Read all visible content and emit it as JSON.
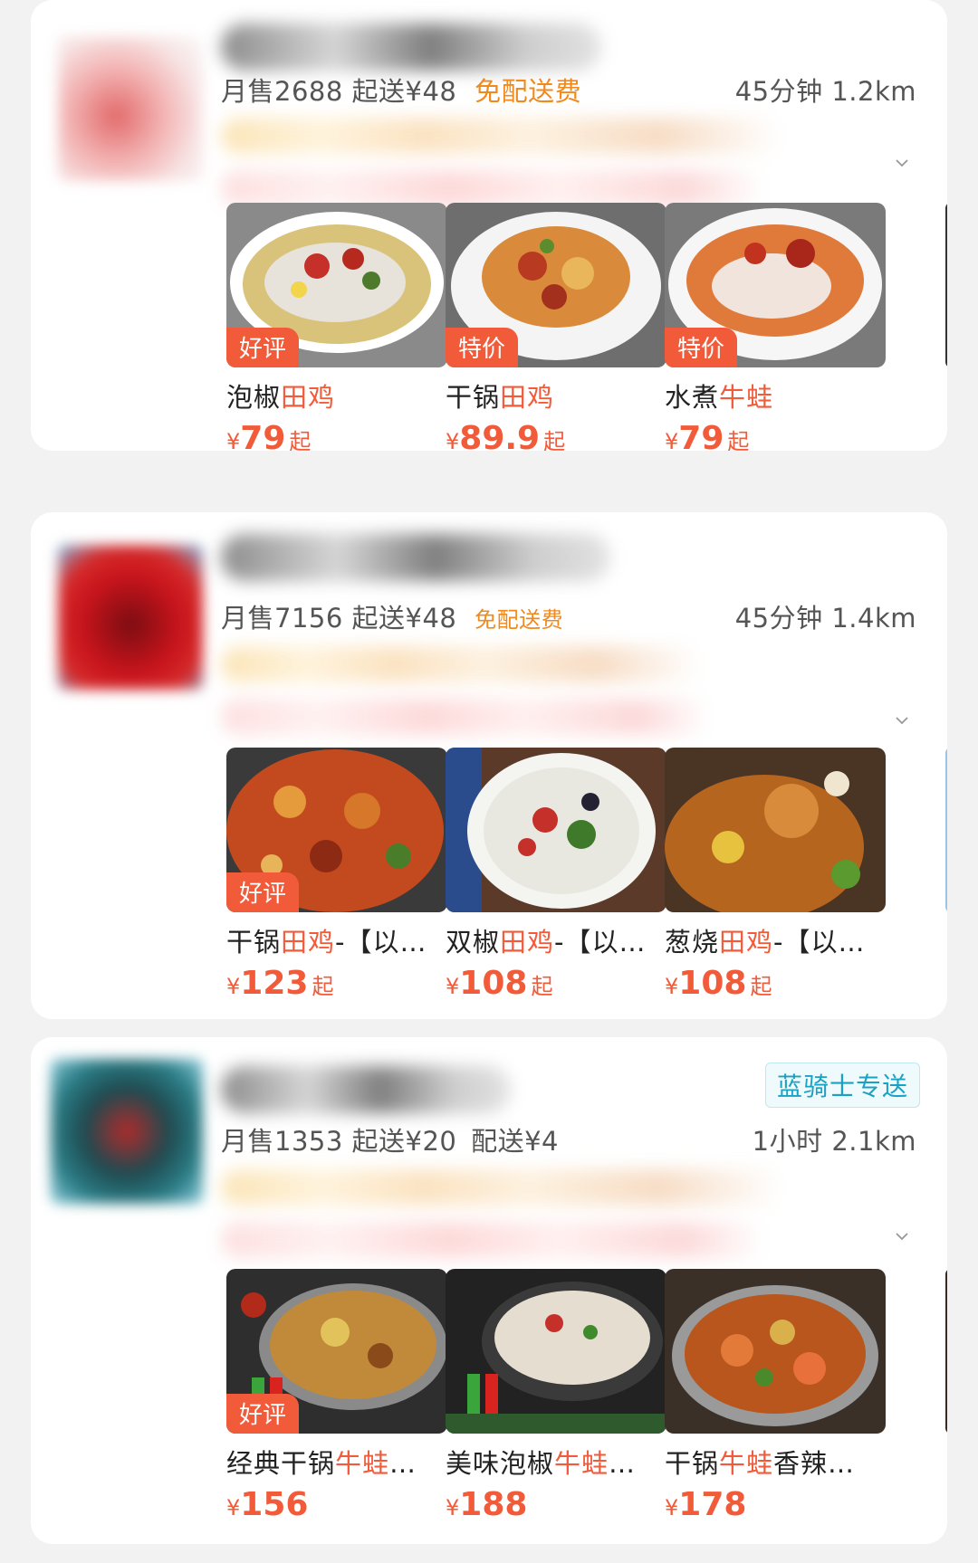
{
  "stores": [
    {
      "monthly_sales": "月售2688",
      "min_order": "起送¥48",
      "delivery": "免配送费",
      "time_distance": "45分钟 1.2km",
      "badge": "",
      "dishes": [
        {
          "tag": "好评",
          "name_prefix": "泡椒",
          "name_highlight": "田鸡",
          "name_suffix": "",
          "yen": "¥",
          "price": "79",
          "from": "起"
        },
        {
          "tag": "特价",
          "name_prefix": "干锅",
          "name_highlight": "田鸡",
          "name_suffix": "",
          "yen": "¥",
          "price": "89.9",
          "from": "起"
        },
        {
          "tag": "特价",
          "name_prefix": "水煮",
          "name_highlight": "牛蛙",
          "name_suffix": "",
          "yen": "¥",
          "price": "79",
          "from": "起"
        }
      ]
    },
    {
      "monthly_sales": "月售7156",
      "min_order": "起送¥48",
      "delivery": "免配送费",
      "time_distance": "45分钟 1.4km",
      "badge": "",
      "dishes": [
        {
          "tag": "好评",
          "name_prefix": "干锅",
          "name_highlight": "田鸡",
          "name_suffix": "-【以…",
          "yen": "¥",
          "price": "123",
          "from": "起"
        },
        {
          "tag": "",
          "name_prefix": "双椒",
          "name_highlight": "田鸡",
          "name_suffix": "-【以…",
          "yen": "¥",
          "price": "108",
          "from": "起"
        },
        {
          "tag": "",
          "name_prefix": "葱烧",
          "name_highlight": "田鸡",
          "name_suffix": "-【以…",
          "yen": "¥",
          "price": "108",
          "from": "起"
        }
      ]
    },
    {
      "monthly_sales": "月售1353",
      "min_order": "起送¥20",
      "delivery": "配送¥4",
      "time_distance": "1小时 2.1km",
      "badge": "蓝骑士专送",
      "dishes": [
        {
          "tag": "好评",
          "name_prefix": "经典干锅",
          "name_highlight": "牛蛙",
          "name_suffix": "…",
          "yen": "¥",
          "price": "156",
          "from": ""
        },
        {
          "tag": "",
          "name_prefix": "美味泡椒",
          "name_highlight": "牛蛙",
          "name_suffix": "…",
          "yen": "¥",
          "price": "188",
          "from": ""
        },
        {
          "tag": "",
          "name_prefix": "干锅",
          "name_highlight": "牛蛙",
          "name_suffix": "香辣…",
          "yen": "¥",
          "price": "178",
          "from": ""
        }
      ]
    }
  ],
  "icons": {
    "expand": "chevron-down-icon"
  },
  "colors": {
    "accent": "#f25b3a",
    "free_delivery": "#f08a1c",
    "badge": "#1aa2c4"
  }
}
